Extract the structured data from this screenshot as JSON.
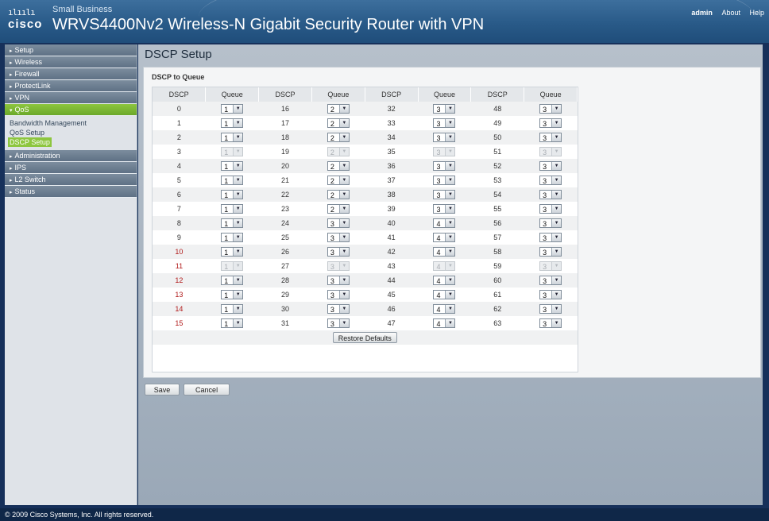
{
  "header": {
    "logo_bars": "ılıılı",
    "logo_word": "cisco",
    "small_business": "Small Business",
    "product_title": "WRVS4400Nv2 Wireless-N Gigabit Security Router with VPN",
    "links": {
      "user": "admin",
      "about": "About",
      "help": "Help"
    }
  },
  "sidebar": {
    "items": [
      {
        "label": "Setup"
      },
      {
        "label": "Wireless"
      },
      {
        "label": "Firewall"
      },
      {
        "label": "ProtectLink"
      },
      {
        "label": "VPN"
      },
      {
        "label": "QoS",
        "active": true
      }
    ],
    "qos_sub": {
      "bandwidth": "Bandwidth Management",
      "qos_setup": "QoS Setup",
      "dscp_setup": "DSCP Setup"
    },
    "items_after": [
      {
        "label": "Administration"
      },
      {
        "label": "IPS"
      },
      {
        "label": "L2 Switch"
      },
      {
        "label": "Status"
      }
    ]
  },
  "main": {
    "page_title": "DSCP Setup",
    "section_title": "DSCP to Queue",
    "headers": [
      "DSCP",
      "Queue",
      "DSCP",
      "Queue",
      "DSCP",
      "Queue",
      "DSCP",
      "Queue"
    ],
    "rows": [
      [
        [
          "0",
          "1",
          false
        ],
        [
          "16",
          "2",
          false
        ],
        [
          "32",
          "3",
          false
        ],
        [
          "48",
          "3",
          false
        ]
      ],
      [
        [
          "1",
          "1",
          false
        ],
        [
          "17",
          "2",
          false
        ],
        [
          "33",
          "3",
          false
        ],
        [
          "49",
          "3",
          false
        ]
      ],
      [
        [
          "2",
          "1",
          false
        ],
        [
          "18",
          "2",
          false
        ],
        [
          "34",
          "3",
          false
        ],
        [
          "50",
          "3",
          false
        ]
      ],
      [
        [
          "3",
          "1",
          true
        ],
        [
          "19",
          "2",
          true
        ],
        [
          "35",
          "3",
          true
        ],
        [
          "51",
          "3",
          true
        ]
      ],
      [
        [
          "4",
          "1",
          false
        ],
        [
          "20",
          "2",
          false
        ],
        [
          "36",
          "3",
          false
        ],
        [
          "52",
          "3",
          false
        ]
      ],
      [
        [
          "5",
          "1",
          false
        ],
        [
          "21",
          "2",
          false
        ],
        [
          "37",
          "3",
          false
        ],
        [
          "53",
          "3",
          false
        ]
      ],
      [
        [
          "6",
          "1",
          false
        ],
        [
          "22",
          "2",
          false
        ],
        [
          "38",
          "3",
          false
        ],
        [
          "54",
          "3",
          false
        ]
      ],
      [
        [
          "7",
          "1",
          false
        ],
        [
          "23",
          "2",
          false
        ],
        [
          "39",
          "3",
          false
        ],
        [
          "55",
          "3",
          false
        ]
      ],
      [
        [
          "8",
          "1",
          false
        ],
        [
          "24",
          "3",
          false
        ],
        [
          "40",
          "4",
          false
        ],
        [
          "56",
          "3",
          false
        ]
      ],
      [
        [
          "9",
          "1",
          false
        ],
        [
          "25",
          "3",
          false
        ],
        [
          "41",
          "4",
          false
        ],
        [
          "57",
          "3",
          false
        ]
      ],
      [
        [
          "10",
          "1",
          false
        ],
        [
          "26",
          "3",
          false
        ],
        [
          "42",
          "4",
          false
        ],
        [
          "58",
          "3",
          false
        ]
      ],
      [
        [
          "11",
          "1",
          true
        ],
        [
          "27",
          "3",
          true
        ],
        [
          "43",
          "4",
          true
        ],
        [
          "59",
          "3",
          true
        ]
      ],
      [
        [
          "12",
          "1",
          false
        ],
        [
          "28",
          "3",
          false
        ],
        [
          "44",
          "4",
          false
        ],
        [
          "60",
          "3",
          false
        ]
      ],
      [
        [
          "13",
          "1",
          false
        ],
        [
          "29",
          "3",
          false
        ],
        [
          "45",
          "4",
          false
        ],
        [
          "61",
          "3",
          false
        ]
      ],
      [
        [
          "14",
          "1",
          false
        ],
        [
          "30",
          "3",
          false
        ],
        [
          "46",
          "4",
          false
        ],
        [
          "62",
          "3",
          false
        ]
      ],
      [
        [
          "15",
          "1",
          false
        ],
        [
          "31",
          "3",
          false
        ],
        [
          "47",
          "4",
          false
        ],
        [
          "63",
          "3",
          false
        ]
      ]
    ],
    "restore_label": "Restore Defaults",
    "save_label": "Save",
    "cancel_label": "Cancel"
  },
  "footer": {
    "copyright": "© 2009 Cisco Systems, Inc. All rights reserved."
  },
  "colors": {
    "accent_green": "#8dc63f",
    "header_blue": "#295a88",
    "nav_gray": "#6f8195",
    "dscp_red": "#b01818"
  }
}
